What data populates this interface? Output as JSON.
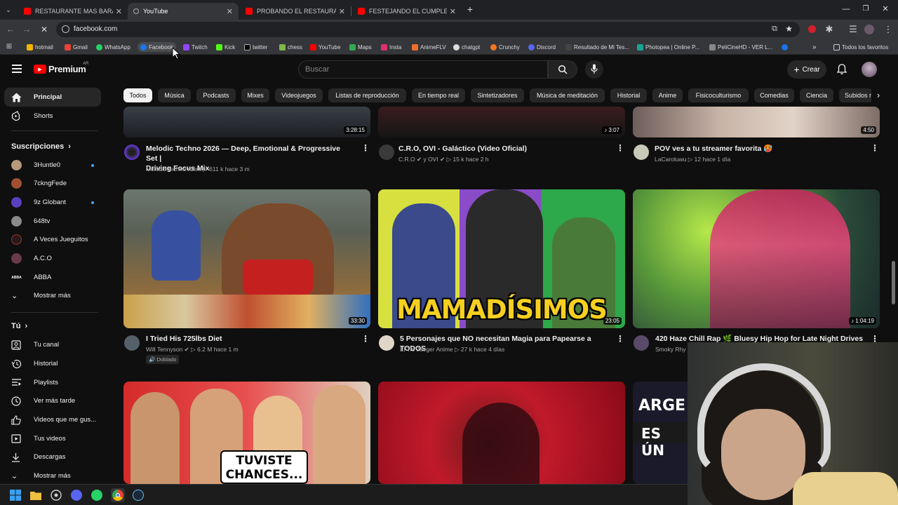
{
  "browser": {
    "tabs": [
      {
        "title": "RESTAURANTE MAS BARATO vs",
        "favicon": "youtube-icon",
        "active": false
      },
      {
        "title": "YouTube",
        "favicon": "loading-icon",
        "active": true
      },
      {
        "title": "PROBANDO EL RESTAURANTE",
        "favicon": "youtube-icon",
        "active": false
      },
      {
        "title": "FESTEJANDO EL CUMPLEAÑOS",
        "favicon": "youtube-icon",
        "active": false
      }
    ],
    "url": "facebook.com",
    "bookmarks": [
      "hotmail",
      "Gmail",
      "WhatsApp",
      "Facebook",
      "Twitch",
      "Kick",
      "twitter",
      "chess",
      "YouTube",
      "Maps",
      "Insta",
      "AnimeFLV",
      "chatgpt",
      "Crunchy",
      "Discord",
      "Resultado de Mi Tes...",
      "Photopea | Online P...",
      "PeliCineHD - VER L..."
    ],
    "favorites_label": "Todos los favoritos"
  },
  "yt": {
    "logo": "Premium",
    "country": "AR",
    "search_placeholder": "Buscar",
    "create_label": "Crear",
    "chips": [
      "Todos",
      "Música",
      "Podcasts",
      "Mixes",
      "Videojuegos",
      "Listas de reproducción",
      "En tiempo real",
      "Sintetizadores",
      "Música de meditación",
      "Historial",
      "Anime",
      "Fisicoculturismo",
      "Comedias",
      "Ciencia",
      "Subidos r"
    ]
  },
  "sidebar": {
    "main": [
      "Principal",
      "Shorts"
    ],
    "subs_header": "Suscripciones",
    "subs": [
      "3Huntle0",
      "7ckngFede",
      "9z Globant",
      "648tv",
      "A Veces Jueguitos",
      "A.C.O",
      "ABBA"
    ],
    "show_more": "Mostrar más",
    "you_header": "Tú",
    "you": [
      "Tu canal",
      "Historial",
      "Playlists",
      "Ver más tarde",
      "Videos que me gus...",
      "Tus videos",
      "Descargas"
    ],
    "show_more2": "Mostrar más"
  },
  "videos": {
    "row1": [
      {
        "title1": "Melodic Techno 2026 — Deep, Emotional & Progressive Set |",
        "title2": "Driving Focus Mix",
        "channel": "Melodic techno room",
        "views": "611 k",
        "age": "hace 3 m",
        "duration": "3:28:15"
      },
      {
        "title1": "C.R.O, OVI - Galáctico (Video Oficial)",
        "title2": "",
        "channel": "C.R.O ✔ y OVI ✔",
        "views": "15 k",
        "age": "hace 2 h",
        "duration": "3:07"
      },
      {
        "title1": "POV ves a tu streamer favorita 🥵",
        "title2": "",
        "channel": "LaCaroluwu",
        "views": "12",
        "age": "hace 1 día",
        "duration": "4:50"
      }
    ],
    "row2": [
      {
        "title": "I Tried His 725lbs Diet",
        "channel": "Will Tennyson ✔",
        "views": "6.2 M",
        "age": "hace 1 m",
        "badge": "Doblado",
        "duration": "33:30"
      },
      {
        "title": "5 Personajes que NO necesitan Magia para Papearse a TODOS",
        "channel": "El Tio Jaeger Anime",
        "views": "27 k",
        "age": "hace 4 días",
        "duration": "23:05",
        "thumb_text": "MAMADÍSIMOS"
      },
      {
        "title": "420 Haze Chill Rap 🌿 Bluesy Hip Hop for Late Night Drives",
        "channel": "Smoky Rhy",
        "duration": "1:04:19"
      }
    ],
    "row3": [
      {
        "thumb_text1": "TUVISTE",
        "thumb_text2": "CHANCES..."
      },
      {},
      {
        "thumb_text1": "ARGE",
        "thumb_text2": "ES ÚN"
      }
    ]
  }
}
